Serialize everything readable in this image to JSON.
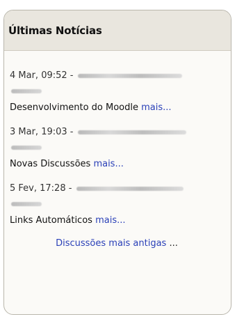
{
  "block": {
    "title": "Últimas Notícias"
  },
  "posts": [
    {
      "date": "4 Mar, 09:52 -",
      "subject": "Desenvolvimento do Moodle",
      "more": "mais..."
    },
    {
      "date": "3 Mar, 19:03 -",
      "subject": "Novas Discussões",
      "more": "mais..."
    },
    {
      "date": "5 Fev, 17:28 -",
      "subject": "Links Automáticos",
      "more": "mais..."
    }
  ],
  "footer": {
    "older_link": "Discussões mais antigas",
    "ellipsis": "..."
  },
  "colors": {
    "link": "#2a40b8",
    "header_bg": "#e9e6de"
  }
}
